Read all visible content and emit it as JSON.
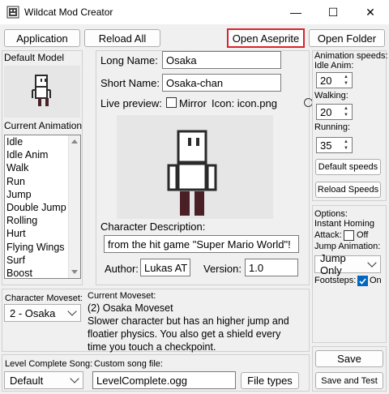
{
  "window": {
    "title": "Wildcat Mod Creator",
    "minimize": "—",
    "maximize": "☐",
    "close": "✕"
  },
  "toolbar": {
    "application": "Application",
    "reload_all": "Reload All",
    "open_aseprite": "Open Aseprite",
    "open_folder": "Open Folder"
  },
  "left": {
    "default_model_label": "Default Model",
    "current_animation_label": "Current Animation",
    "animations": [
      "Idle",
      "Idle Anim",
      "Walk",
      "Run",
      "Jump",
      "Double Jump",
      "Rolling",
      "Hurt",
      "Flying Wings",
      "Surf",
      "Boost"
    ]
  },
  "center": {
    "long_name_label": "Long Name:",
    "long_name_value": "Osaka",
    "short_name_label": "Short Name:",
    "short_name_value": "Osaka-chan",
    "live_preview_label": "Live preview:",
    "mirror_label": "Mirror",
    "icon_label": "Icon: icon.png",
    "description_label": "Character Description:",
    "description_value": "from the hit game \"Super Mario World\"!",
    "author_label": "Author:",
    "author_value": "Lukas AT",
    "version_label": "Version:",
    "version_value": "1.0"
  },
  "right": {
    "animation_speeds_label": "Animation speeds:",
    "idle_anim_label": "Idle Anim:",
    "idle_anim_value": "20",
    "walking_label": "Walking:",
    "walking_value": "20",
    "running_label": "Running:",
    "running_value": "35",
    "default_speeds": "Default speeds",
    "reload_speeds": "Reload Speeds",
    "options_label": "Options:",
    "instant_homing_label": "Instant Homing",
    "attack_label": "Attack:",
    "attack_off": "Off",
    "jump_animation_label": "Jump Animation:",
    "jump_animation_value": "Jump Only",
    "footsteps_label": "Footsteps:",
    "footsteps_value": "On",
    "save": "Save",
    "save_and_test": "Save and Test"
  },
  "moveset": {
    "character_moveset_label": "Character Moveset:",
    "selected": "2 - Osaka",
    "current_moveset_label": "Current Moveset:",
    "title": "(2) Osaka Moveset",
    "description": "Slower character but has an higher jump and floatier physics. You also get a shield every time you touch a checkpoint."
  },
  "song": {
    "level_complete_label": "Level Complete Song:",
    "selected": "Default",
    "custom_file_label": "Custom song file:",
    "custom_file_value": "LevelComplete.ogg",
    "file_types": "File types"
  },
  "colors": {
    "accent": "#0067c0",
    "highlight": "#d9232d",
    "panel": "#f0f0f0"
  }
}
